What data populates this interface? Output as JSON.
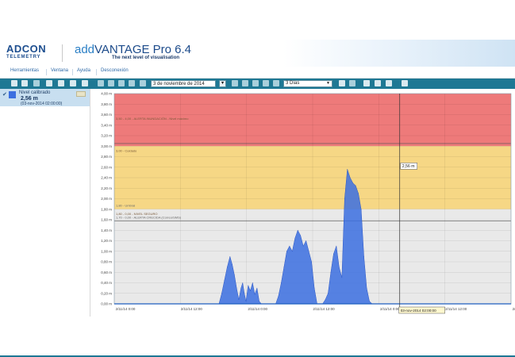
{
  "app": {
    "logo_text": "ADCON",
    "logo_subtext": "TELEMETRY",
    "title_prefix": "add",
    "title_main": "VANTAGE Pro 6.4",
    "tagline": "The next level of visualisation"
  },
  "menu": {
    "items": [
      "Herramientas",
      "Ventana",
      "Ayuda",
      "Desconexión"
    ]
  },
  "toolbar": {
    "date_value": "3 de noviembre de 2014",
    "period_value": "3 Días"
  },
  "sensor": {
    "name": "Nivel calibrado",
    "value": "2,56 m",
    "timestamp": "(03-nov-2014 02:00:00)",
    "color": "#3b6fe0"
  },
  "chart_data": {
    "type": "area",
    "y_tick_labels": [
      "0,00 m",
      "0,20 m",
      "0,40 m",
      "0,60 m",
      "0,80 m",
      "1,00 m",
      "1,20 m",
      "1,40 m",
      "1,60 m",
      "1,80 m",
      "2,00 m",
      "2,20 m",
      "2,40 m",
      "2,60 m",
      "2,80 m",
      "3,00 m",
      "3,20 m",
      "3,40 m",
      "3,60 m",
      "3,80 m",
      "4,00 m"
    ],
    "ylim": [
      0,
      4.0
    ],
    "x_tick_labels": [
      "2/11/14 0:00",
      "2/11/14 12:00",
      "2/11/14 0:00",
      "2/11/14 12:00",
      "2/11/14 0:00",
      "2/11/14 12:00",
      "2/11/14 0:00"
    ],
    "xlim_hours": [
      0,
      72
    ],
    "bands": [
      {
        "from": 3.0,
        "to": 4.0,
        "color": "#ee7a7a",
        "label": "3,50 - 4,00 - ALERTA INUNDACIÓN - Nivel máximo"
      },
      {
        "from": 1.8,
        "to": 3.0,
        "color": "#f6d785",
        "label": "3,00 - Cuidado"
      },
      {
        "from": 0.0,
        "to": 1.8,
        "color": "#e9e9e9",
        "label": "1,80 - 0,00 - NIVEL SEGURO"
      }
    ],
    "band_sublabels": [
      "1,80 - Umbral",
      "1,70 - 0,00 - ALERTA CRECIDA (Correo/SMS)"
    ],
    "series": [
      {
        "x": [
          0,
          19,
          19.5,
          20,
          20.5,
          21,
          21.4,
          21.8,
          22.2,
          22.6,
          23,
          23.3,
          23.6,
          23.9,
          24.3,
          24.7,
          25.1,
          25.5,
          25.9,
          26.3,
          26.7,
          27.1,
          27.5,
          27.9,
          28.3,
          28.8,
          29.3,
          29.8,
          30.3,
          30.8,
          31.3,
          31.8,
          32.3,
          32.8,
          33.3,
          33.8,
          34.3,
          34.8,
          35.3,
          35.8,
          36.3,
          36.8,
          37.3,
          37.8,
          38.3,
          38.8,
          39.3,
          39.8,
          40.3,
          40.8,
          41.3,
          41.8,
          42.3,
          42.8,
          43.3,
          43.8,
          44.3,
          44.8,
          45.3,
          45.8,
          46.3,
          46.8,
          47.3,
          47.8,
          48.3,
          48.8,
          49.3,
          49.8,
          50.3,
          50.8,
          51.3,
          51.8,
          52.3,
          52.8,
          53.3,
          53.8,
          54.3,
          54.8,
          55.3,
          55.8,
          56.3,
          56.8,
          57.3,
          57.8,
          58.3,
          72
        ],
        "y": [
          0,
          0,
          0.2,
          0.45,
          0.7,
          0.9,
          0.75,
          0.55,
          0.3,
          0.08,
          0.3,
          0.4,
          0.2,
          0.05,
          0.35,
          0.25,
          0.4,
          0.18,
          0.3,
          0.05,
          0,
          0,
          0,
          0,
          0,
          0,
          0,
          0.15,
          0.4,
          0.7,
          1.0,
          1.1,
          1.0,
          1.25,
          1.4,
          1.3,
          1.1,
          1.2,
          1.0,
          0.8,
          0.3,
          0,
          0,
          0,
          0.08,
          0.2,
          0.6,
          0.95,
          1.1,
          0.7,
          0.5,
          2.0,
          2.56,
          2.4,
          2.3,
          2.25,
          2.1,
          1.8,
          0.9,
          0.3,
          0.05,
          0,
          0,
          0,
          0,
          0,
          0,
          0,
          0,
          0,
          0,
          0,
          0,
          0,
          0,
          0,
          0,
          0,
          0,
          0,
          0,
          0,
          0,
          0,
          0,
          0
        ]
      }
    ],
    "cursor": {
      "x": 51.8,
      "value_label": "2,56 m",
      "date_label": "03-nov-2014 02:00:00"
    },
    "grid": true
  }
}
